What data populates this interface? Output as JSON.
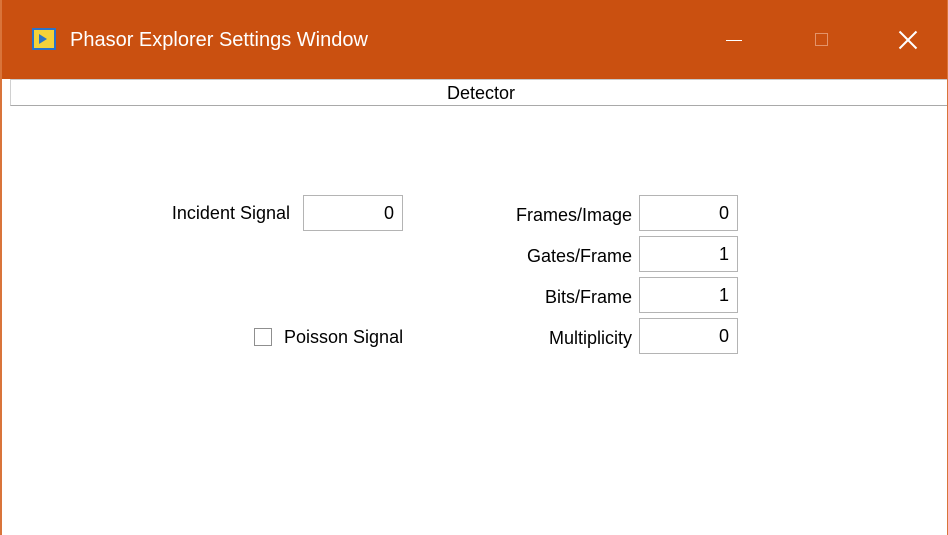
{
  "window": {
    "title": "Phasor Explorer Settings Window",
    "icon": "labview-vi-icon",
    "controls": {
      "minimize_icon": "minimize-icon",
      "maximize_icon": "maximize-icon",
      "close_icon": "close-icon"
    },
    "accent_color": "#ca5010"
  },
  "tab": {
    "label": "Detector"
  },
  "form": {
    "incident_signal": {
      "label": "Incident Signal",
      "value": "0"
    },
    "poisson_signal": {
      "label": "Poisson Signal",
      "checked": false
    },
    "frames_per_image": {
      "label": "Frames/Image",
      "value": "0"
    },
    "gates_per_frame": {
      "label": "Gates/Frame",
      "value": "1"
    },
    "bits_per_frame": {
      "label": "Bits/Frame",
      "value": "1"
    },
    "multiplicity": {
      "label": "Multiplicity",
      "value": "0"
    }
  }
}
